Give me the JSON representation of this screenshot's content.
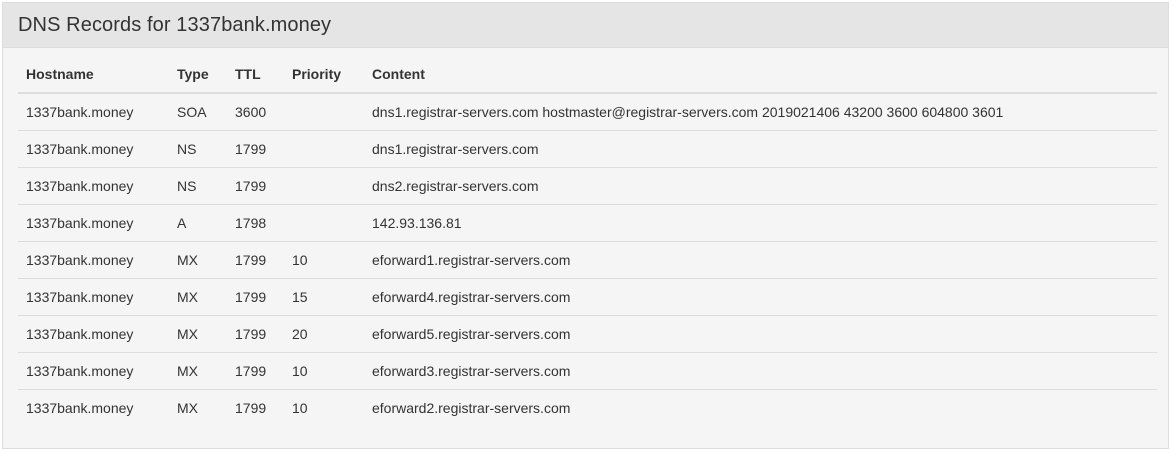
{
  "panel": {
    "title": "DNS Records for 1337bank.money"
  },
  "table": {
    "headers": {
      "hostname": "Hostname",
      "type": "Type",
      "ttl": "TTL",
      "priority": "Priority",
      "content": "Content"
    },
    "rows": [
      {
        "hostname": "1337bank.money",
        "type": "SOA",
        "ttl": "3600",
        "priority": "",
        "content": "dns1.registrar-servers.com hostmaster@registrar-servers.com 2019021406 43200 3600 604800 3601"
      },
      {
        "hostname": "1337bank.money",
        "type": "NS",
        "ttl": "1799",
        "priority": "",
        "content": "dns1.registrar-servers.com"
      },
      {
        "hostname": "1337bank.money",
        "type": "NS",
        "ttl": "1799",
        "priority": "",
        "content": "dns2.registrar-servers.com"
      },
      {
        "hostname": "1337bank.money",
        "type": "A",
        "ttl": "1798",
        "priority": "",
        "content": "142.93.136.81"
      },
      {
        "hostname": "1337bank.money",
        "type": "MX",
        "ttl": "1799",
        "priority": "10",
        "content": "eforward1.registrar-servers.com"
      },
      {
        "hostname": "1337bank.money",
        "type": "MX",
        "ttl": "1799",
        "priority": "15",
        "content": "eforward4.registrar-servers.com"
      },
      {
        "hostname": "1337bank.money",
        "type": "MX",
        "ttl": "1799",
        "priority": "20",
        "content": "eforward5.registrar-servers.com"
      },
      {
        "hostname": "1337bank.money",
        "type": "MX",
        "ttl": "1799",
        "priority": "10",
        "content": "eforward3.registrar-servers.com"
      },
      {
        "hostname": "1337bank.money",
        "type": "MX",
        "ttl": "1799",
        "priority": "10",
        "content": "eforward2.registrar-servers.com"
      }
    ]
  }
}
